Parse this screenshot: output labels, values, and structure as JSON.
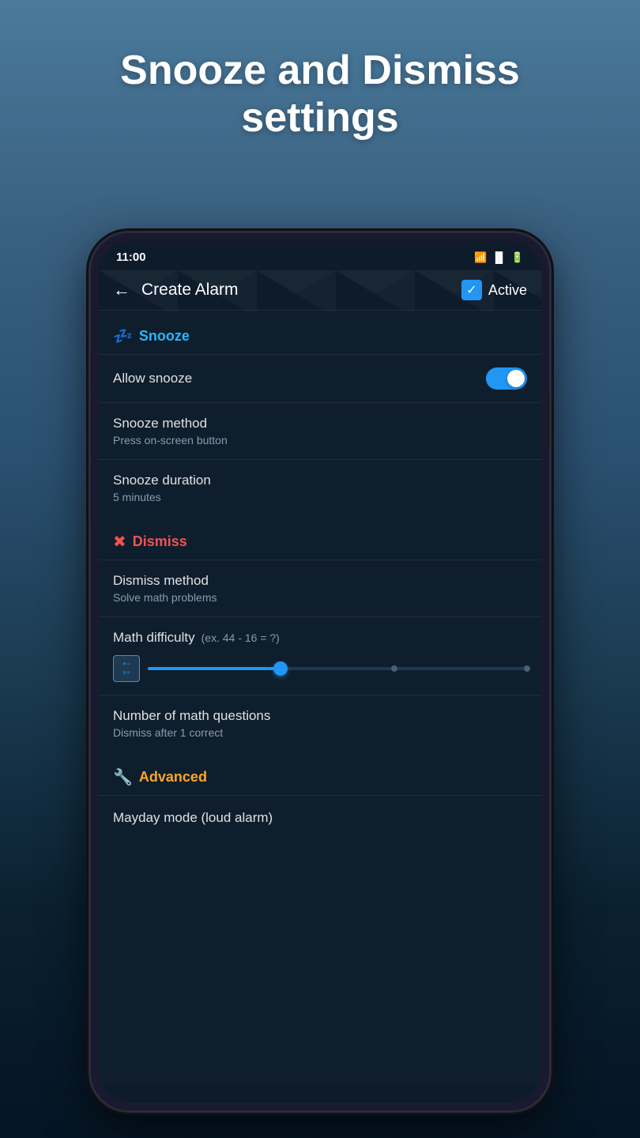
{
  "hero": {
    "title": "Snooze and Dismiss settings"
  },
  "status_bar": {
    "time": "11:00",
    "wifi_icon": "wifi",
    "signal_icon": "signal",
    "battery_icon": "battery"
  },
  "header": {
    "back_label": "←",
    "title": "Create Alarm",
    "active_label": "Active"
  },
  "snooze_section": {
    "icon": "💤",
    "title": "Snooze",
    "allow_snooze": {
      "label": "Allow snooze",
      "enabled": true
    },
    "snooze_method": {
      "label": "Snooze method",
      "value": "Press on-screen button"
    },
    "snooze_duration": {
      "label": "Snooze duration",
      "value": "5 minutes"
    }
  },
  "dismiss_section": {
    "icon": "✖",
    "title": "Dismiss",
    "dismiss_method": {
      "label": "Dismiss method",
      "value": "Solve math problems"
    },
    "math_difficulty": {
      "label": "Math difficulty",
      "example": "(ex. 44 - 16 = ?)",
      "slider_percent": 35
    },
    "math_questions": {
      "label": "Number of math questions",
      "value": "Dismiss after 1 correct"
    }
  },
  "advanced_section": {
    "icon": "🔧",
    "title": "Advanced",
    "mayday_mode": {
      "label": "Mayday mode (loud alarm)"
    }
  }
}
